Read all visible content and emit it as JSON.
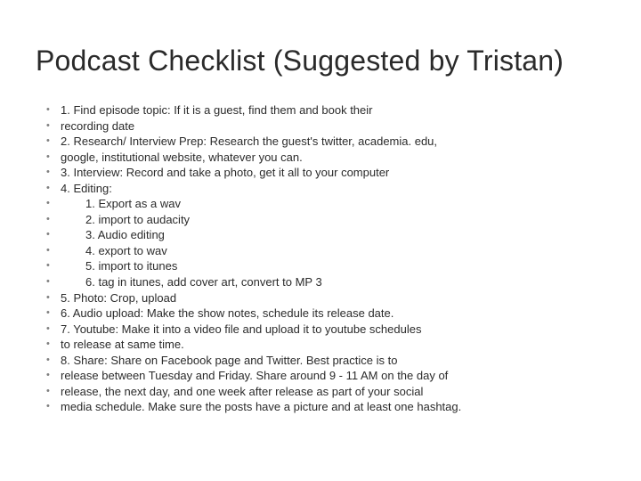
{
  "title": "Podcast Checklist (Suggested by Tristan)",
  "lines": [
    "1. Find episode topic: If it is a guest, find them and book their",
    "recording date",
    "2. Research/ Interview Prep: Research the guest's twitter, academia. edu,",
    "google, institutional website, whatever you can.",
    "3. Interview: Record and take a photo, get it all to your computer",
    "4. Editing:",
    "1. Export as a wav",
    "2. import to audacity",
    "3. Audio editing",
    "4. export to wav",
    "5. import to itunes",
    "6. tag in itunes, add cover art, convert to MP 3",
    "5. Photo: Crop, upload",
    "6. Audio upload: Make the show notes, schedule its release date.",
    "7. Youtube: Make it into a video file and upload it to youtube schedules",
    "to release at same time.",
    "8. Share: Share on Facebook page and Twitter. Best practice is to",
    "release between Tuesday and Friday. Share around 9 - 11 AM on the day of",
    "release, the next day, and one week after release as part of your social",
    "media schedule. Make sure the posts have a picture and at least one hashtag."
  ],
  "indents": [
    6,
    7,
    8,
    9,
    10,
    11
  ]
}
